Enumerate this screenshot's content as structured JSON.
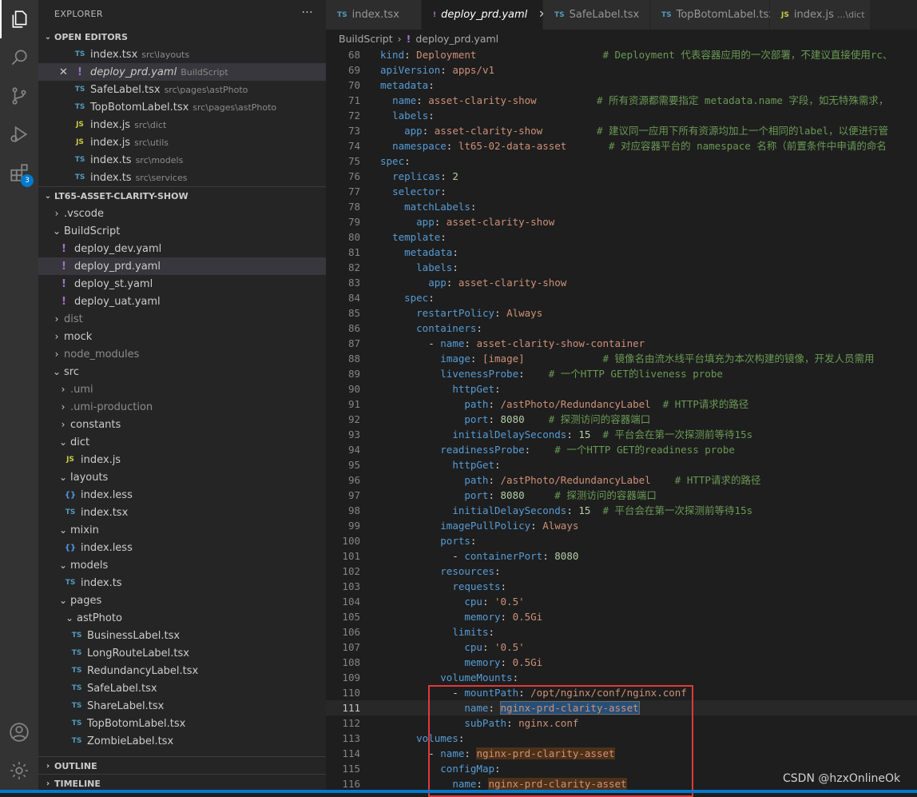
{
  "sidebar": {
    "title": "EXPLORER",
    "more": "···",
    "open_editors_title": "OPEN EDITORS",
    "open_editors": [
      {
        "icon": "TS",
        "type": "ts",
        "name": "index.tsx",
        "path": "src\\layouts"
      },
      {
        "icon": "!",
        "type": "yaml",
        "name": "deploy_prd.yaml",
        "path": "BuildScript"
      },
      {
        "icon": "TS",
        "type": "ts",
        "name": "SafeLabel.tsx",
        "path": "src\\pages\\astPhoto"
      },
      {
        "icon": "TS",
        "type": "ts",
        "name": "TopBotomLabel.tsx",
        "path": "src\\pages\\astPhoto"
      },
      {
        "icon": "JS",
        "type": "js",
        "name": "index.js",
        "path": "src\\dict"
      },
      {
        "icon": "JS",
        "type": "js",
        "name": "index.js",
        "path": "src\\utils"
      },
      {
        "icon": "TS",
        "type": "ts",
        "name": "index.ts",
        "path": "src\\models"
      },
      {
        "icon": "TS",
        "type": "ts",
        "name": "index.ts",
        "path": "src\\services"
      }
    ],
    "project_title": "LT65-ASSET-CLARITY-SHOW",
    "tree": [
      {
        "twisty": "›",
        "name": ".vscode"
      },
      {
        "twisty": "⌄",
        "name": "BuildScript"
      },
      {
        "icon": "!",
        "type": "yaml",
        "name": "deploy_dev.yaml"
      },
      {
        "icon": "!",
        "type": "yaml",
        "name": "deploy_prd.yaml"
      },
      {
        "icon": "!",
        "type": "yaml",
        "name": "deploy_st.yaml"
      },
      {
        "icon": "!",
        "type": "yaml",
        "name": "deploy_uat.yaml"
      },
      {
        "twisty": "›",
        "name": "dist"
      },
      {
        "twisty": "›",
        "name": "mock"
      },
      {
        "twisty": "›",
        "name": "node_modules"
      },
      {
        "twisty": "⌄",
        "name": "src"
      },
      {
        "twisty": "›",
        "name": ".umi"
      },
      {
        "twisty": "›",
        "name": ".umi-production"
      },
      {
        "twisty": "›",
        "name": "constants"
      },
      {
        "twisty": "⌄",
        "name": "dict"
      },
      {
        "icon": "JS",
        "type": "js",
        "name": "index.js"
      },
      {
        "twisty": "⌄",
        "name": "layouts"
      },
      {
        "icon": "{}",
        "type": "less",
        "name": "index.less"
      },
      {
        "icon": "TS",
        "type": "ts",
        "name": "index.tsx"
      },
      {
        "twisty": "⌄",
        "name": "mixin"
      },
      {
        "icon": "{}",
        "type": "less",
        "name": "index.less"
      },
      {
        "twisty": "⌄",
        "name": "models"
      },
      {
        "icon": "TS",
        "type": "ts",
        "name": "index.ts"
      },
      {
        "twisty": "⌄",
        "name": "pages"
      },
      {
        "twisty": "⌄",
        "name": "astPhoto"
      },
      {
        "icon": "TS",
        "type": "ts",
        "name": "BusinessLabel.tsx"
      },
      {
        "icon": "TS",
        "type": "ts",
        "name": "LongRouteLabel.tsx"
      },
      {
        "icon": "TS",
        "type": "ts",
        "name": "RedundancyLabel.tsx"
      },
      {
        "icon": "TS",
        "type": "ts",
        "name": "SafeLabel.tsx"
      },
      {
        "icon": "TS",
        "type": "ts",
        "name": "ShareLabel.tsx"
      },
      {
        "icon": "TS",
        "type": "ts",
        "name": "TopBotomLabel.tsx"
      },
      {
        "icon": "TS",
        "type": "ts",
        "name": "ZombieLabel.tsx"
      }
    ],
    "outline_title": "OUTLINE",
    "timeline_title": "TIMELINE"
  },
  "activity_badge": "3",
  "tabs": [
    {
      "icon": "TS",
      "type": "ts",
      "label": "index.tsx"
    },
    {
      "icon": "!",
      "type": "yaml",
      "label": "deploy_prd.yaml"
    },
    {
      "icon": "TS",
      "type": "ts",
      "label": "SafeLabel.tsx"
    },
    {
      "icon": "TS",
      "type": "ts",
      "label": "TopBotomLabel.tsx"
    },
    {
      "icon": "JS",
      "type": "js",
      "label": "index.js",
      "sub": "...\\dict"
    }
  ],
  "breadcrumb": {
    "folder": "BuildScript",
    "sep": "›",
    "icon": "!",
    "file": "deploy_prd.yaml"
  },
  "code_lines": [
    {
      "n": "68",
      "t": [
        [
          "k",
          "kind"
        ],
        [
          "p",
          ": "
        ],
        [
          "s",
          "Deployment"
        ],
        [
          "p",
          "                     "
        ],
        [
          "c",
          "# Deployment 代表容器应用的一次部署，不建议直接使用rc、"
        ]
      ]
    },
    {
      "n": "69",
      "t": [
        [
          "k",
          "apiVersion"
        ],
        [
          "p",
          ": "
        ],
        [
          "s",
          "apps/v1"
        ]
      ]
    },
    {
      "n": "70",
      "t": [
        [
          "k",
          "metadata"
        ],
        [
          "p",
          ":"
        ]
      ]
    },
    {
      "n": "71",
      "t": [
        [
          "p",
          "  "
        ],
        [
          "k",
          "name"
        ],
        [
          "p",
          ": "
        ],
        [
          "s",
          "asset-clarity-show"
        ],
        [
          "p",
          "          "
        ],
        [
          "c",
          "# 所有资源都需要指定 metadata.name 字段，如无特殊需求，"
        ]
      ]
    },
    {
      "n": "72",
      "t": [
        [
          "p",
          "  "
        ],
        [
          "k",
          "labels"
        ],
        [
          "p",
          ":"
        ]
      ]
    },
    {
      "n": "73",
      "t": [
        [
          "p",
          "    "
        ],
        [
          "k",
          "app"
        ],
        [
          "p",
          ": "
        ],
        [
          "s",
          "asset-clarity-show"
        ],
        [
          "p",
          "         "
        ],
        [
          "c",
          "# 建议同一应用下所有资源均加上一个相同的label，以便进行管"
        ]
      ]
    },
    {
      "n": "74",
      "t": [
        [
          "p",
          "  "
        ],
        [
          "k",
          "namespace"
        ],
        [
          "p",
          ": "
        ],
        [
          "s",
          "lt65-02-data-asset"
        ],
        [
          "p",
          "       "
        ],
        [
          "c",
          "# 对应容器平台的 namespace 名称（前置条件中申请的命名"
        ]
      ]
    },
    {
      "n": "75",
      "t": [
        [
          "k",
          "spec"
        ],
        [
          "p",
          ":"
        ]
      ]
    },
    {
      "n": "76",
      "t": [
        [
          "p",
          "  "
        ],
        [
          "k",
          "replicas"
        ],
        [
          "p",
          ": "
        ],
        [
          "n",
          "2"
        ]
      ]
    },
    {
      "n": "77",
      "t": [
        [
          "p",
          "  "
        ],
        [
          "k",
          "selector"
        ],
        [
          "p",
          ":"
        ]
      ]
    },
    {
      "n": "78",
      "t": [
        [
          "p",
          "    "
        ],
        [
          "k",
          "matchLabels"
        ],
        [
          "p",
          ":"
        ]
      ]
    },
    {
      "n": "79",
      "t": [
        [
          "p",
          "      "
        ],
        [
          "k",
          "app"
        ],
        [
          "p",
          ": "
        ],
        [
          "s",
          "asset-clarity-show"
        ]
      ]
    },
    {
      "n": "80",
      "t": [
        [
          "p",
          "  "
        ],
        [
          "k",
          "template"
        ],
        [
          "p",
          ":"
        ]
      ]
    },
    {
      "n": "81",
      "t": [
        [
          "p",
          "    "
        ],
        [
          "k",
          "metadata"
        ],
        [
          "p",
          ":"
        ]
      ]
    },
    {
      "n": "82",
      "t": [
        [
          "p",
          "      "
        ],
        [
          "k",
          "labels"
        ],
        [
          "p",
          ":"
        ]
      ]
    },
    {
      "n": "83",
      "t": [
        [
          "p",
          "        "
        ],
        [
          "k",
          "app"
        ],
        [
          "p",
          ": "
        ],
        [
          "s",
          "asset-clarity-show"
        ]
      ]
    },
    {
      "n": "84",
      "t": [
        [
          "p",
          "    "
        ],
        [
          "k",
          "spec"
        ],
        [
          "p",
          ":"
        ]
      ]
    },
    {
      "n": "85",
      "t": [
        [
          "p",
          "      "
        ],
        [
          "k",
          "restartPolicy"
        ],
        [
          "p",
          ": "
        ],
        [
          "s",
          "Always"
        ]
      ]
    },
    {
      "n": "86",
      "t": [
        [
          "p",
          "      "
        ],
        [
          "k",
          "containers"
        ],
        [
          "p",
          ":"
        ]
      ]
    },
    {
      "n": "87",
      "t": [
        [
          "p",
          "        - "
        ],
        [
          "k",
          "name"
        ],
        [
          "p",
          ": "
        ],
        [
          "s",
          "asset-clarity-show-container"
        ]
      ]
    },
    {
      "n": "88",
      "t": [
        [
          "p",
          "          "
        ],
        [
          "k",
          "image"
        ],
        [
          "p",
          ": "
        ],
        [
          "s",
          "[image]"
        ],
        [
          "p",
          "             "
        ],
        [
          "c",
          "# 镜像名由流水线平台填充为本次构建的镜像，开发人员需用"
        ]
      ]
    },
    {
      "n": "89",
      "t": [
        [
          "p",
          "          "
        ],
        [
          "k",
          "livenessProbe"
        ],
        [
          "p",
          ":    "
        ],
        [
          "c",
          "# 一个HTTP GET的liveness probe"
        ]
      ]
    },
    {
      "n": "90",
      "t": [
        [
          "p",
          "            "
        ],
        [
          "k",
          "httpGet"
        ],
        [
          "p",
          ":"
        ]
      ]
    },
    {
      "n": "91",
      "t": [
        [
          "p",
          "              "
        ],
        [
          "k",
          "path"
        ],
        [
          "p",
          ": "
        ],
        [
          "s",
          "/astPhoto/RedundancyLabel"
        ],
        [
          "p",
          "  "
        ],
        [
          "c",
          "# HTTP请求的路径"
        ]
      ]
    },
    {
      "n": "92",
      "t": [
        [
          "p",
          "              "
        ],
        [
          "k",
          "port"
        ],
        [
          "p",
          ": "
        ],
        [
          "n",
          "8080"
        ],
        [
          "p",
          "    "
        ],
        [
          "c",
          "# 探测访问的容器端口"
        ]
      ]
    },
    {
      "n": "93",
      "t": [
        [
          "p",
          "            "
        ],
        [
          "k",
          "initialDelaySeconds"
        ],
        [
          "p",
          ": "
        ],
        [
          "n",
          "15"
        ],
        [
          "p",
          "  "
        ],
        [
          "c",
          "# 平台会在第一次探测前等待15s"
        ]
      ]
    },
    {
      "n": "94",
      "t": [
        [
          "p",
          "          "
        ],
        [
          "k",
          "readinessProbe"
        ],
        [
          "p",
          ":    "
        ],
        [
          "c",
          "# 一个HTTP GET的readiness probe"
        ]
      ]
    },
    {
      "n": "95",
      "t": [
        [
          "p",
          "            "
        ],
        [
          "k",
          "httpGet"
        ],
        [
          "p",
          ":"
        ]
      ]
    },
    {
      "n": "96",
      "t": [
        [
          "p",
          "              "
        ],
        [
          "k",
          "path"
        ],
        [
          "p",
          ": "
        ],
        [
          "s",
          "/astPhoto/RedundancyLabel"
        ],
        [
          "p",
          "    "
        ],
        [
          "c",
          "# HTTP请求的路径"
        ]
      ]
    },
    {
      "n": "97",
      "t": [
        [
          "p",
          "              "
        ],
        [
          "k",
          "port"
        ],
        [
          "p",
          ": "
        ],
        [
          "n",
          "8080"
        ],
        [
          "p",
          "     "
        ],
        [
          "c",
          "# 探测访问的容器端口"
        ]
      ]
    },
    {
      "n": "98",
      "t": [
        [
          "p",
          "            "
        ],
        [
          "k",
          "initialDelaySeconds"
        ],
        [
          "p",
          ": "
        ],
        [
          "n",
          "15"
        ],
        [
          "p",
          "  "
        ],
        [
          "c",
          "# 平台会在第一次探测前等待15s"
        ]
      ]
    },
    {
      "n": "99",
      "t": [
        [
          "p",
          "          "
        ],
        [
          "k",
          "imagePullPolicy"
        ],
        [
          "p",
          ": "
        ],
        [
          "s",
          "Always"
        ]
      ]
    },
    {
      "n": "100",
      "t": [
        [
          "p",
          "          "
        ],
        [
          "k",
          "ports"
        ],
        [
          "p",
          ":"
        ]
      ]
    },
    {
      "n": "101",
      "t": [
        [
          "p",
          "            - "
        ],
        [
          "k",
          "containerPort"
        ],
        [
          "p",
          ": "
        ],
        [
          "n",
          "8080"
        ]
      ]
    },
    {
      "n": "102",
      "t": [
        [
          "p",
          "          "
        ],
        [
          "k",
          "resources"
        ],
        [
          "p",
          ":"
        ]
      ]
    },
    {
      "n": "103",
      "t": [
        [
          "p",
          "            "
        ],
        [
          "k",
          "requests"
        ],
        [
          "p",
          ":"
        ]
      ]
    },
    {
      "n": "104",
      "t": [
        [
          "p",
          "              "
        ],
        [
          "k",
          "cpu"
        ],
        [
          "p",
          ": "
        ],
        [
          "s",
          "'0.5'"
        ]
      ]
    },
    {
      "n": "105",
      "t": [
        [
          "p",
          "              "
        ],
        [
          "k",
          "memory"
        ],
        [
          "p",
          ": "
        ],
        [
          "s",
          "0.5Gi"
        ]
      ]
    },
    {
      "n": "106",
      "t": [
        [
          "p",
          "            "
        ],
        [
          "k",
          "limits"
        ],
        [
          "p",
          ":"
        ]
      ]
    },
    {
      "n": "107",
      "t": [
        [
          "p",
          "              "
        ],
        [
          "k",
          "cpu"
        ],
        [
          "p",
          ": "
        ],
        [
          "s",
          "'0.5'"
        ]
      ]
    },
    {
      "n": "108",
      "t": [
        [
          "p",
          "              "
        ],
        [
          "k",
          "memory"
        ],
        [
          "p",
          ": "
        ],
        [
          "s",
          "0.5Gi"
        ]
      ]
    },
    {
      "n": "109",
      "t": [
        [
          "p",
          "          "
        ],
        [
          "k",
          "volumeMounts"
        ],
        [
          "p",
          ":"
        ]
      ]
    },
    {
      "n": "110",
      "t": [
        [
          "p",
          "            - "
        ],
        [
          "k",
          "mountPath"
        ],
        [
          "p",
          ": "
        ],
        [
          "s",
          "/opt/nginx/conf/nginx.conf"
        ]
      ]
    },
    {
      "n": "111",
      "t": [
        [
          "p",
          "              "
        ],
        [
          "k",
          "name"
        ],
        [
          "p",
          ": "
        ],
        [
          "sel",
          "nginx-prd-clarity-asset"
        ]
      ]
    },
    {
      "n": "112",
      "t": [
        [
          "p",
          "              "
        ],
        [
          "k",
          "subPath"
        ],
        [
          "p",
          ": "
        ],
        [
          "s",
          "nginx.conf"
        ]
      ]
    },
    {
      "n": "113",
      "t": [
        [
          "p",
          "      "
        ],
        [
          "k",
          "volumes"
        ],
        [
          "p",
          ":"
        ]
      ]
    },
    {
      "n": "114",
      "t": [
        [
          "p",
          "        - "
        ],
        [
          "k",
          "name"
        ],
        [
          "p",
          ": "
        ],
        [
          "hl",
          "nginx-prd-clarity-asset"
        ]
      ]
    },
    {
      "n": "115",
      "t": [
        [
          "p",
          "          "
        ],
        [
          "k",
          "configMap"
        ],
        [
          "p",
          ":"
        ]
      ]
    },
    {
      "n": "116",
      "t": [
        [
          "p",
          "            "
        ],
        [
          "k",
          "name"
        ],
        [
          "p",
          ": "
        ],
        [
          "hl",
          "nginx-prd-clarity-asset"
        ]
      ]
    }
  ],
  "watermark": "CSDN @hzxOnlineOk"
}
